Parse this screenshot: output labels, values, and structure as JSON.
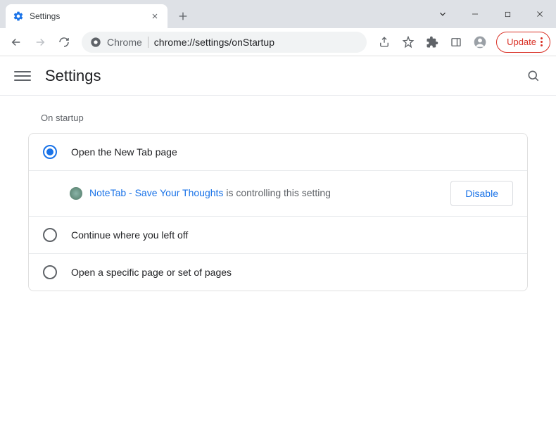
{
  "window": {
    "tab_title": "Settings"
  },
  "toolbar": {
    "address_prefix": "Chrome",
    "address_url": "chrome://settings/onStartup",
    "update_label": "Update"
  },
  "header": {
    "title": "Settings"
  },
  "startup": {
    "section_title": "On startup",
    "options": [
      {
        "label": "Open the New Tab page",
        "selected": true
      },
      {
        "label": "Continue where you left off",
        "selected": false
      },
      {
        "label": "Open a specific page or set of pages",
        "selected": false
      }
    ],
    "controlling_extension": {
      "name": "NoteTab - Save Your Thoughts",
      "suffix": " is controlling this setting",
      "disable_label": "Disable"
    }
  }
}
